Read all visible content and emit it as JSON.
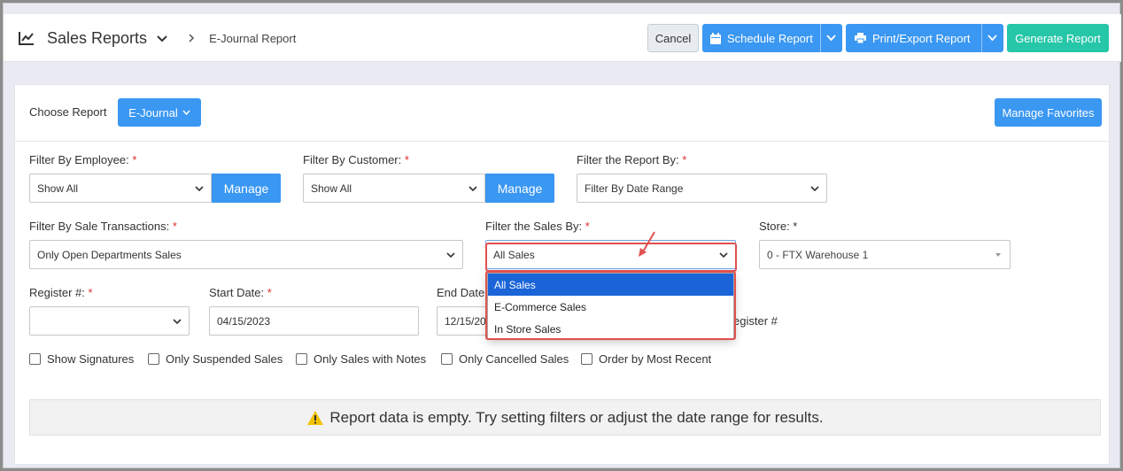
{
  "header": {
    "title": "Sales Reports",
    "breadcrumb_sub": "E-Journal Report",
    "cancel_label": "Cancel",
    "schedule_label": "Schedule Report",
    "export_label": "Print/Export Report",
    "generate_label": "Generate Report"
  },
  "choose_report": {
    "label": "Choose Report",
    "button_label": "E-Journal",
    "manage_favorites_label": "Manage Favorites"
  },
  "filters": {
    "employee": {
      "label": "Filter By Employee:",
      "value": "Show All",
      "manage_label": "Manage"
    },
    "customer": {
      "label": "Filter By Customer:",
      "value": "Show All",
      "manage_label": "Manage"
    },
    "report_by": {
      "label": "Filter the Report By:",
      "value": "Filter By Date Range"
    },
    "sale_transactions": {
      "label": "Filter By Sale Transactions:",
      "value": "Only Open Departments Sales"
    },
    "sales_by": {
      "label": "Filter the Sales By:",
      "value": "All Sales",
      "options": [
        "All Sales",
        "E-Commerce Sales",
        "In Store Sales"
      ],
      "selected_index": 0
    },
    "store": {
      "label": "Store: *",
      "value": "0 - FTX Warehouse 1"
    },
    "register": {
      "label": "Register #:",
      "value": ""
    },
    "start_date": {
      "label": "Start Date:",
      "value": "04/15/2023"
    },
    "end_date": {
      "label": "End Date",
      "value": "12/15/20"
    },
    "group_by_register_text": "egister #"
  },
  "checkboxes": [
    {
      "label": "Show Signatures",
      "checked": false
    },
    {
      "label": "Only Suspended Sales",
      "checked": false
    },
    {
      "label": "Only Sales with Notes",
      "checked": false
    },
    {
      "label": "Only Cancelled Sales",
      "checked": false
    },
    {
      "label": "Order by Most Recent",
      "checked": false
    }
  ],
  "empty_message": "Report data is empty. Try setting filters or adjust the date range for results.",
  "colors": {
    "primary": "#3a97f2",
    "success": "#26c6a8",
    "required": "#e02d2d",
    "highlight": "#e05050",
    "option_selected": "#1a64d8"
  },
  "icons": [
    "line-chart-icon",
    "chevron-down-icon",
    "chevron-right-icon",
    "calendar-icon",
    "printer-icon",
    "warning-icon",
    "red-arrow-icon"
  ]
}
